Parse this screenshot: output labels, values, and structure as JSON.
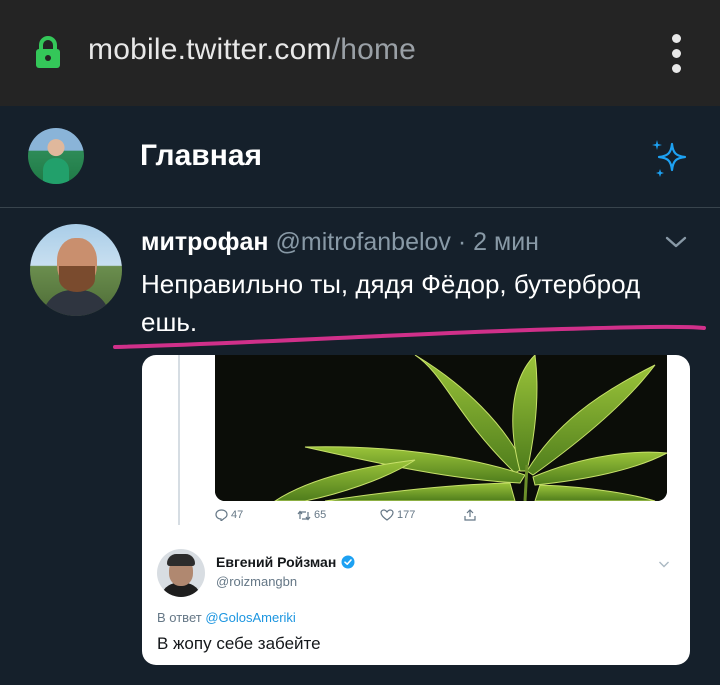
{
  "browser": {
    "url_host": "mobile.twitter.com",
    "url_path": "/home",
    "lock_icon": "lock-icon",
    "menu_icon": "more-vert-icon"
  },
  "header": {
    "title": "Главная",
    "sparkle_icon": "sparkle-icon"
  },
  "tweet": {
    "author_name": "митрофан",
    "author_handle": "@mitrofanbelov",
    "separator": "·",
    "time": "2 мин",
    "text": "Неправильно ты, дядя Фёдор, бутерброд ешь.",
    "embedded": {
      "actions": {
        "replies": "47",
        "retweets": "65",
        "likes": "177"
      },
      "quote": {
        "name": "Евгений Ройзман",
        "handle": "@roizmangbn",
        "reply_prefix": "В ответ",
        "reply_mention": "@GolosAmeriki",
        "text": "В жопу себе забейте"
      }
    }
  },
  "colors": {
    "background": "#15202b",
    "browser_bar": "#242424",
    "accent": "#1da1f2",
    "underline": "#d0308a",
    "lock_green": "#34c759"
  }
}
